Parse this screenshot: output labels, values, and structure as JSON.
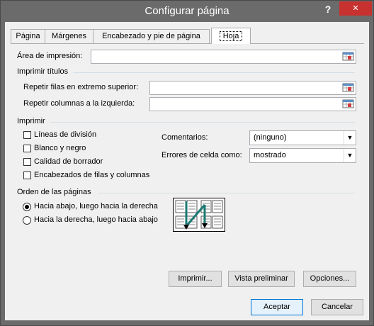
{
  "window": {
    "title": "Configurar página",
    "help_label": "?",
    "close_label": "✕"
  },
  "tabs": [
    {
      "label": "Página"
    },
    {
      "label": "Márgenes"
    },
    {
      "label": "Encabezado y pie de página"
    },
    {
      "label": "Hoja",
      "active": true
    }
  ],
  "print_area": {
    "label": "Área de impresión:",
    "value": ""
  },
  "print_titles": {
    "heading": "Imprimir títulos",
    "rows_label": "Repetir filas en extremo superior:",
    "rows_value": "",
    "cols_label": "Repetir columnas a la izquierda:",
    "cols_value": ""
  },
  "print": {
    "heading": "Imprimir",
    "checkboxes": [
      {
        "label": "Líneas de división",
        "checked": false
      },
      {
        "label": "Blanco y negro",
        "checked": false
      },
      {
        "label": "Calidad de borrador",
        "checked": false
      },
      {
        "label": "Encabezados de filas y columnas",
        "checked": false
      }
    ],
    "comments_label": "Comentarios:",
    "comments_value": "(ninguno)",
    "errors_label": "Errores de celda como:",
    "errors_value": "mostrado"
  },
  "page_order": {
    "heading": "Orden de las páginas",
    "options": [
      {
        "label": "Hacia abajo, luego hacia la derecha",
        "selected": true
      },
      {
        "label": "Hacia la derecha, luego hacia abajo",
        "selected": false
      }
    ]
  },
  "buttons": {
    "print": "Imprimir...",
    "preview": "Vista preliminar",
    "options": "Opciones...",
    "accept": "Aceptar",
    "cancel": "Cancelar"
  },
  "colors": {
    "titlebar": "#6b6b6b",
    "close": "#c7312f",
    "accent": "#0078d7"
  },
  "icons": [
    "collapse-dialog-icon",
    "page-order-diagram-icon"
  ]
}
